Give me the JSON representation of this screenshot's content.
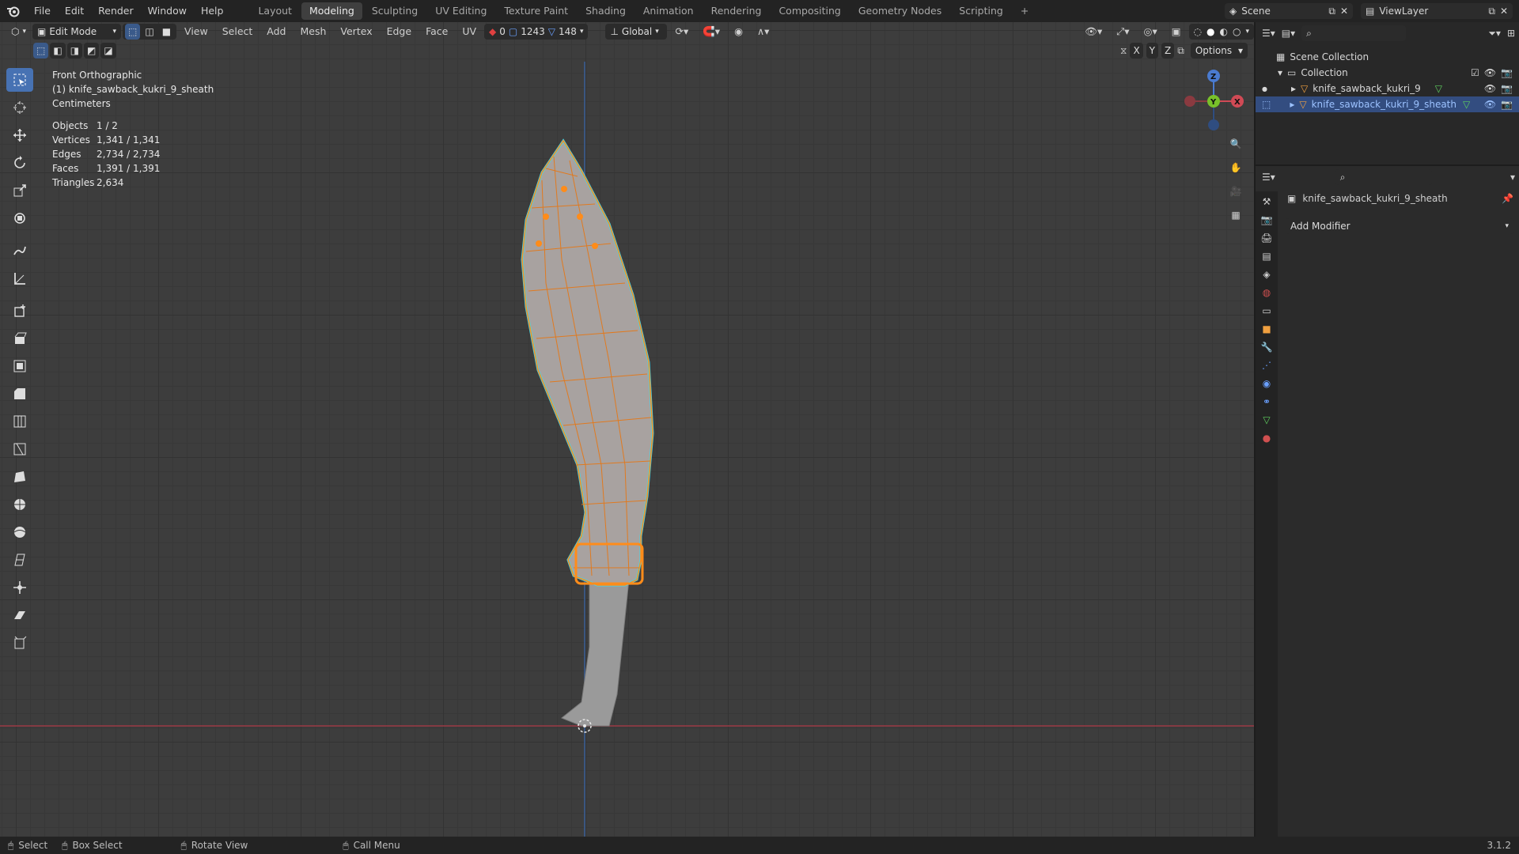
{
  "menu": [
    "File",
    "Edit",
    "Render",
    "Window",
    "Help"
  ],
  "workspaces": [
    "Layout",
    "Modeling",
    "Sculpting",
    "UV Editing",
    "Texture Paint",
    "Shading",
    "Animation",
    "Rendering",
    "Compositing",
    "Geometry Nodes",
    "Scripting"
  ],
  "active_workspace": "Modeling",
  "scene": {
    "name": "Scene",
    "view_layer": "ViewLayer"
  },
  "viewport_header": {
    "mode": "Edit Mode",
    "menus": [
      "View",
      "Select",
      "Add",
      "Mesh",
      "Vertex",
      "Edge",
      "Face",
      "UV"
    ],
    "uv_counts": [
      "0",
      "1243",
      "148"
    ],
    "orientation": "Global",
    "options": "Options",
    "axes": [
      "X",
      "Y",
      "Z"
    ]
  },
  "overlay_text": {
    "view_name": "Front Orthographic",
    "object_name": "(1) knife_sawback_kukri_9_sheath",
    "units": "Centimeters"
  },
  "stats": [
    {
      "label": "Objects",
      "value": "1 / 2"
    },
    {
      "label": "Vertices",
      "value": "1,341 / 1,341"
    },
    {
      "label": "Edges",
      "value": "2,734 / 2,734"
    },
    {
      "label": "Faces",
      "value": "1,391 / 1,391"
    },
    {
      "label": "Triangles",
      "value": "2,634"
    }
  ],
  "gizmo": {
    "z": "Z",
    "y": "Y",
    "x": "X"
  },
  "outliner": {
    "scene_collection": "Scene Collection",
    "collection": "Collection",
    "objects": [
      "knife_sawback_kukri_9",
      "knife_sawback_kukri_9_sheath"
    ]
  },
  "properties": {
    "object_name": "knife_sawback_kukri_9_sheath",
    "add_modifier": "Add Modifier"
  },
  "statusbar": {
    "select": "Select",
    "box_select": "Box Select",
    "rotate_view": "Rotate View",
    "call_menu": "Call Menu",
    "version": "3.1.2"
  },
  "colors": {
    "accent": "#4772b3",
    "selection": "#ff8c1a",
    "edge_highlight": "#44d7e8"
  }
}
